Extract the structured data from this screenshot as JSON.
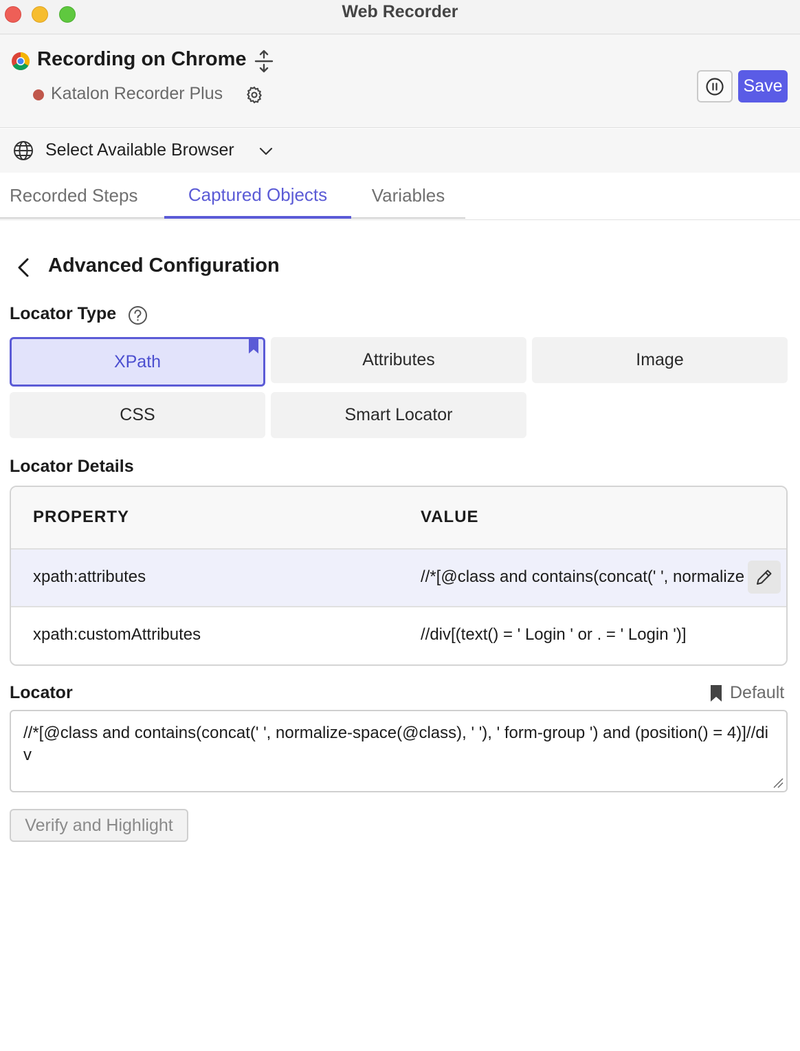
{
  "window": {
    "title": "Web Recorder"
  },
  "header": {
    "recording_title": "Recording on Chrome",
    "extension_name": "Katalon Recorder Plus",
    "save_label": "Save"
  },
  "browser_select": {
    "label": "Select Available Browser"
  },
  "tabs": [
    {
      "label": "Recorded Steps",
      "active": false
    },
    {
      "label": "Captured Objects",
      "active": true
    },
    {
      "label": "Variables",
      "active": false
    }
  ],
  "section": {
    "title": "Advanced Configuration"
  },
  "locator_type": {
    "label": "Locator Type",
    "options": [
      "XPath",
      "Attributes",
      "Image",
      "CSS",
      "Smart Locator"
    ],
    "selected": "XPath"
  },
  "locator_details": {
    "label": "Locator Details",
    "columns": [
      "PROPERTY",
      "VALUE"
    ],
    "rows": [
      {
        "property": "xpath:attributes",
        "value": "//*[@class and contains(concat(' ', normalize-space(@class), ' '), ' form-group ') and (position() = 4)]//div"
      },
      {
        "property": "xpath:customAttributes",
        "value": "//div[(text() = ' Login ' or . = ' Login ')]"
      }
    ]
  },
  "locator": {
    "label": "Locator",
    "default_label": "Default",
    "value": "//*[@class and contains(concat(' ', normalize-space(@class), ' '), ' form-group ') and (position() = 4)]//div"
  },
  "verify_label": "Verify and Highlight",
  "colors": {
    "accent": "#5b5bd6",
    "save": "#5a5ce6",
    "record_dot": "#c0574b"
  }
}
